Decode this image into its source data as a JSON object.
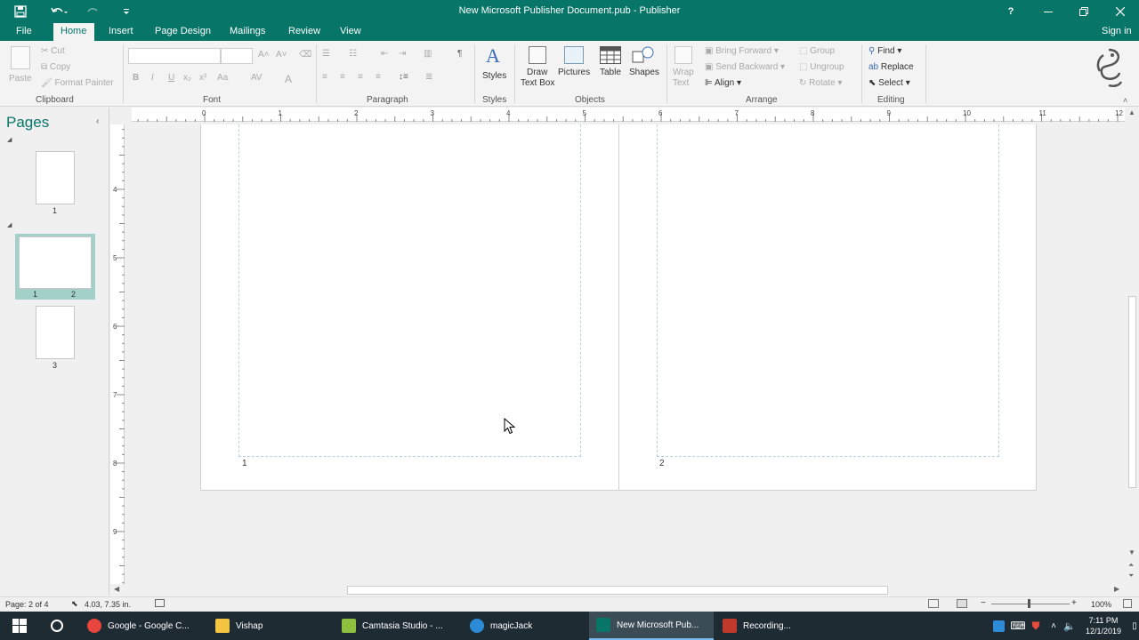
{
  "window": {
    "title": "New Microsoft Publisher Document.pub - Publisher",
    "help": "?",
    "sign_in": "Sign in"
  },
  "tabs": [
    "File",
    "Home",
    "Insert",
    "Page Design",
    "Mailings",
    "Review",
    "View"
  ],
  "active_tab": "Home",
  "ribbon": {
    "clipboard": {
      "label": "Clipboard",
      "paste": "Paste",
      "cut": "Cut",
      "copy": "Copy",
      "format_painter": "Format Painter"
    },
    "font": {
      "label": "Font",
      "bold": "B",
      "italic": "I",
      "underline": "U",
      "font_color": "A"
    },
    "paragraph": {
      "label": "Paragraph",
      "pilcrow": "¶"
    },
    "styles": {
      "label": "Styles",
      "styles": "Styles",
      "glyph": "A"
    },
    "objects": {
      "label": "Objects",
      "draw_text_box_1": "Draw",
      "draw_text_box_2": "Text Box",
      "pictures": "Pictures",
      "table": "Table",
      "shapes": "Shapes"
    },
    "arrange": {
      "label": "Arrange",
      "wrap_text_1": "Wrap",
      "wrap_text_2": "Text",
      "bring_forward": "Bring Forward",
      "send_backward": "Send Backward",
      "align": "Align",
      "group": "Group",
      "ungroup": "Ungroup",
      "rotate": "Rotate"
    },
    "editing": {
      "label": "Editing",
      "find": "Find",
      "replace": "Replace",
      "select": "Select"
    }
  },
  "pages_pane": {
    "title": "Pages",
    "thumbs": [
      {
        "label_left": "1",
        "label_right": ""
      },
      {
        "label_left": "1",
        "label_right": "2"
      },
      {
        "label_left": "3",
        "label_right": ""
      }
    ]
  },
  "rulers": {
    "horizontal": [
      "0",
      "1",
      "2",
      "3",
      "4",
      "5",
      "6",
      "7",
      "8",
      "9",
      "10",
      "11",
      "12"
    ],
    "vertical": [
      "4",
      "5",
      "6",
      "7",
      "8",
      "9"
    ]
  },
  "spread": {
    "left_page_number": "1",
    "right_page_number": "2"
  },
  "status": {
    "page": "Page: 2 of 4",
    "position": "4.03, 7.35 in.",
    "zoom": "100%"
  },
  "taskbar": {
    "items": [
      {
        "label": "Google - Google C...",
        "color": "#e8453c"
      },
      {
        "label": "Vishap",
        "color": "#f4c542"
      },
      {
        "label": "Camtasia Studio - ...",
        "color": "#8fbf3f"
      },
      {
        "label": "magicJack",
        "color": "#2e8bd8"
      },
      {
        "label": "New Microsoft Pub...",
        "color": "#077568"
      },
      {
        "label": "Recording...",
        "color": "#c0392b"
      }
    ],
    "time": "7:11 PM",
    "date": "12/1/2019"
  },
  "colors": {
    "accent": "#077568",
    "taskbar": "#1f2b33"
  }
}
